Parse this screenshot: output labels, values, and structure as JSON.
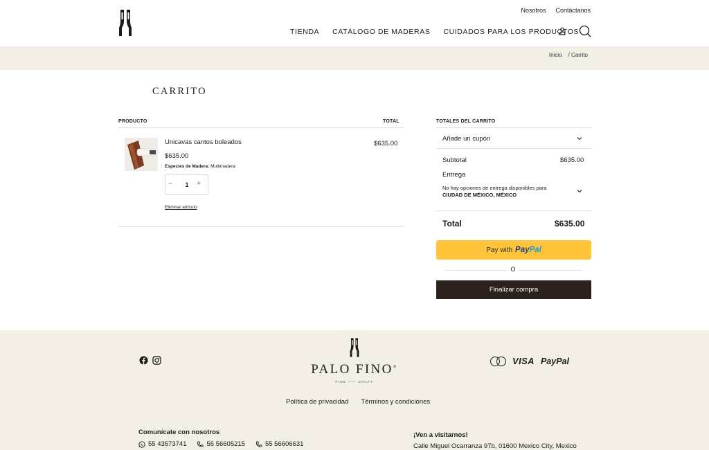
{
  "header": {
    "top_links": [
      "Nosotros",
      "Contáctanos"
    ],
    "nav": [
      "TIENDA",
      "CATÁLOGO DE MADERAS",
      "CUIDADOS PARA LOS PRODUCTOS"
    ]
  },
  "breadcrumb": {
    "home": "Inicio",
    "current": "/ Carrito"
  },
  "page_title": "CARRITO",
  "table": {
    "col_product": "PRODUCTO",
    "col_total": "TOTAL",
    "item": {
      "name": "Unicavas cantos boleados",
      "price": "$635.00",
      "meta_label": "Especies de Madera:",
      "meta_value": "Multimadera",
      "qty_minus": "−",
      "qty_value": "1",
      "qty_plus": "+",
      "remove": "Eliminar artículo",
      "line_total": "$635.00"
    }
  },
  "totals": {
    "heading": "TOTALES DEL CARRITO",
    "coupon": "Añade un cupón",
    "subtotal_label": "Subtotal",
    "subtotal_value": "$635.00",
    "shipping_label": "Entrega",
    "shipping_note": "No hay opciones de entrega disponibles para",
    "shipping_place": "CIUDAD DE MÉXICO, MÉXICO",
    "total_label": "Total",
    "total_value": "$635.00",
    "paypal_prefix": "Pay with",
    "paypal_a": "Pay",
    "paypal_b": "Pal",
    "or": "O",
    "checkout": "Finalizar compra"
  },
  "footer": {
    "brand": "PALO FINO",
    "brand_reg": "®",
    "brand_sub": "FINE —— CRAFT",
    "payments": {
      "card": "MasterCard",
      "visa": "VISA",
      "paypal_a": "Pay",
      "paypal_b": "Pal"
    },
    "links": [
      "Política de privacidad",
      "Términos y condiciones"
    ],
    "contact_heading": "Comunícate con nosotros",
    "phones": [
      "55 43573741",
      "55 56605215",
      "55 56606631"
    ],
    "visit_heading": "¡Ven a visitarnos!",
    "address": "Calle Miguel Ocarranza 97b, 01600 Mexico City, Mexico"
  },
  "colors": {
    "band": "#f3efe4",
    "paypal": "#ffc439",
    "checkout": "#2b211d",
    "text": "#1e1b19"
  },
  "icons": [
    "logo-mark",
    "user-icon",
    "search-icon",
    "chevron-down-icon",
    "facebook-icon",
    "instagram-icon",
    "whatsapp-icon",
    "phone-icon",
    "mastercard-icon"
  ]
}
